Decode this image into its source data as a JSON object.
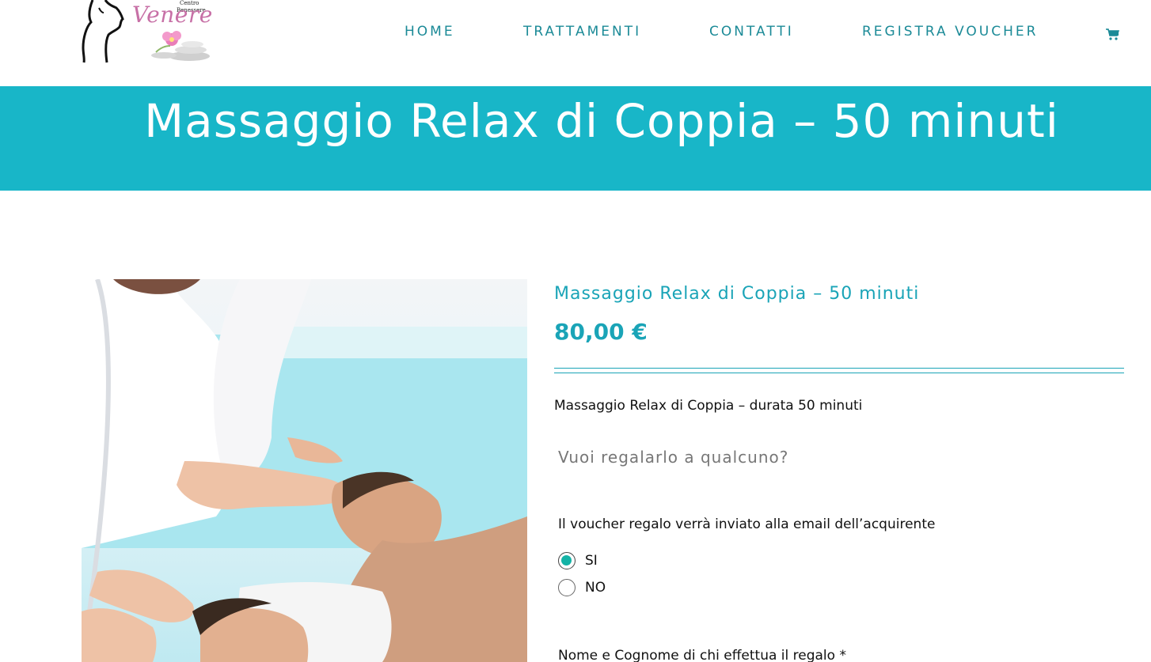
{
  "header": {
    "logo": {
      "brand": "Venere",
      "line1": "Centro",
      "line2": "Benessere"
    },
    "nav": [
      {
        "label": "HOME"
      },
      {
        "label": "TRATTAMENTI"
      },
      {
        "label": "CONTATTI"
      },
      {
        "label": "REGISTRA VOUCHER"
      }
    ],
    "cart_icon": "shopping-cart-icon"
  },
  "banner": {
    "title": "Massaggio Relax di Coppia – 50 minuti"
  },
  "product": {
    "image": "massage-couple-photo",
    "title": "Massaggio Relax di Coppia – 50 minuti",
    "price": "80,00 €",
    "description": "Massaggio Relax di Coppia – durata 50 minuti",
    "gift_question": "Vuoi regalarlo a qualcuno?",
    "voucher_note": "Il voucher regalo verrà inviato alla email dell’acquirente",
    "options": [
      {
        "label": "SI",
        "selected": true
      },
      {
        "label": "NO",
        "selected": false
      }
    ],
    "name_label": "Nome e Cognome di chi effettua il regalo *"
  },
  "colors": {
    "accent": "#18b6c8",
    "nav": "#1b8a97",
    "radio": "#14b3a6"
  }
}
